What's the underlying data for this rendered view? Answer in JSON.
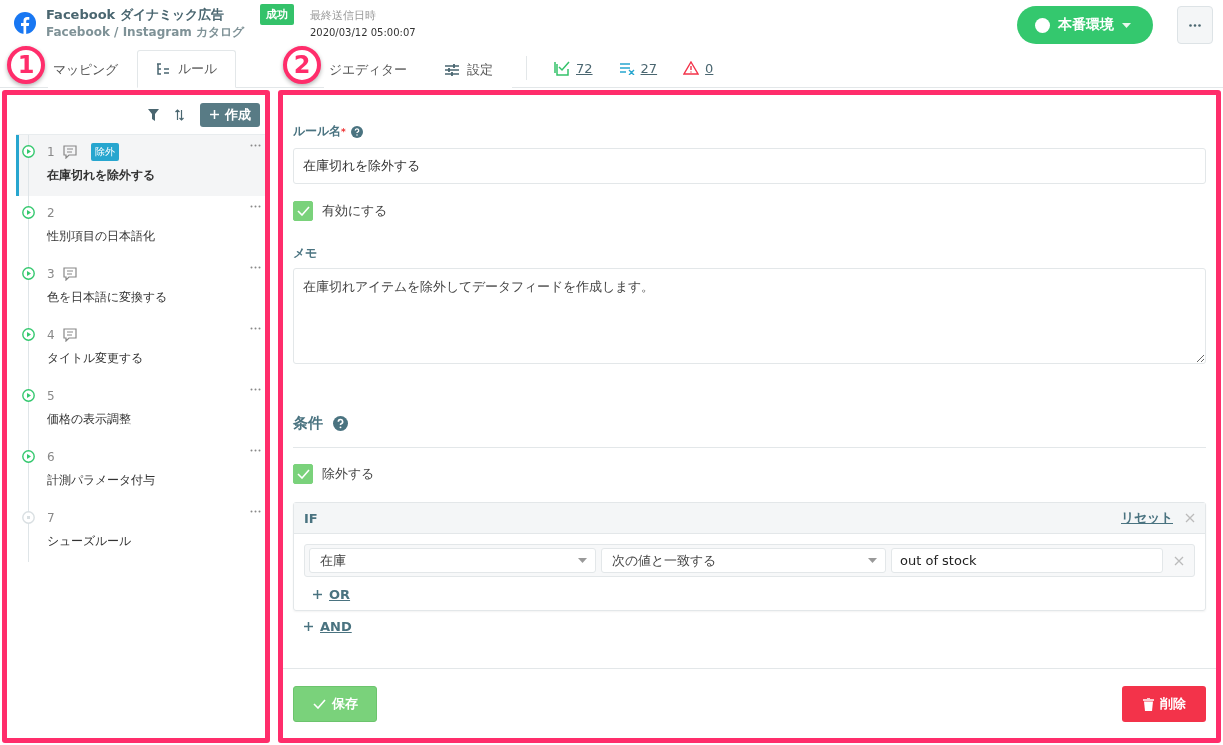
{
  "header": {
    "app_title": "Facebook ダイナミック広告",
    "app_subtitle": "Facebook / Instagram カタログ",
    "status_badge": "成功",
    "last_sent_label": "最終送信日時",
    "last_sent_time": "2020/03/12 05:00:07",
    "environment_button": "本番環境"
  },
  "tabs": [
    {
      "label": "マッピング",
      "kind": "mapping",
      "selected": false
    },
    {
      "label": "ルール",
      "kind": "rules",
      "selected": true
    },
    {
      "label": "ジエディター",
      "kind": "editor",
      "selected": false
    },
    {
      "label": "設定",
      "kind": "settings",
      "selected": false
    }
  ],
  "counters": [
    {
      "value": "72",
      "kind": "valid"
    },
    {
      "value": "27",
      "kind": "excluded"
    },
    {
      "value": "0",
      "kind": "warning"
    }
  ],
  "annotations": [
    {
      "label": "1"
    },
    {
      "label": "2"
    }
  ],
  "rule_list": {
    "create_button": "作成",
    "rules": [
      {
        "number": "1",
        "title": "在庫切れを除外する",
        "memo": true,
        "tag": "除外",
        "selected": true,
        "enabled": true
      },
      {
        "number": "2",
        "title": "性別項目の日本語化",
        "memo": false,
        "selected": false,
        "enabled": true
      },
      {
        "number": "3",
        "title": "色を日本語に変換する",
        "memo": true,
        "selected": false,
        "enabled": true
      },
      {
        "number": "4",
        "title": "タイトル変更する",
        "memo": true,
        "selected": false,
        "enabled": true
      },
      {
        "number": "5",
        "title": "価格の表示調整",
        "memo": false,
        "selected": false,
        "enabled": true
      },
      {
        "number": "6",
        "title": "計測パラメータ付与",
        "memo": false,
        "selected": false,
        "enabled": true
      },
      {
        "number": "7",
        "title": "シューズルール",
        "memo": false,
        "selected": false,
        "enabled": false
      }
    ]
  },
  "editor": {
    "name_label": "ルール名",
    "required_mark": "*",
    "name_value": "在庫切れを除外する",
    "enable_checkbox": {
      "label": "有効にする",
      "checked": true
    },
    "memo_label": "メモ",
    "memo_value": "在庫切れアイテムを除外してデータフィードを作成します。",
    "conditions_title": "条件",
    "exclude_checkbox": {
      "label": "除外する",
      "checked": true
    },
    "condition_block": {
      "title": "IF",
      "reset_link": "リセット",
      "field": "在庫",
      "operator": "次の値と一致する",
      "value": "out of stock",
      "or_link": "OR"
    },
    "and_link": "AND",
    "save_button": "保存",
    "delete_button": "削除"
  }
}
